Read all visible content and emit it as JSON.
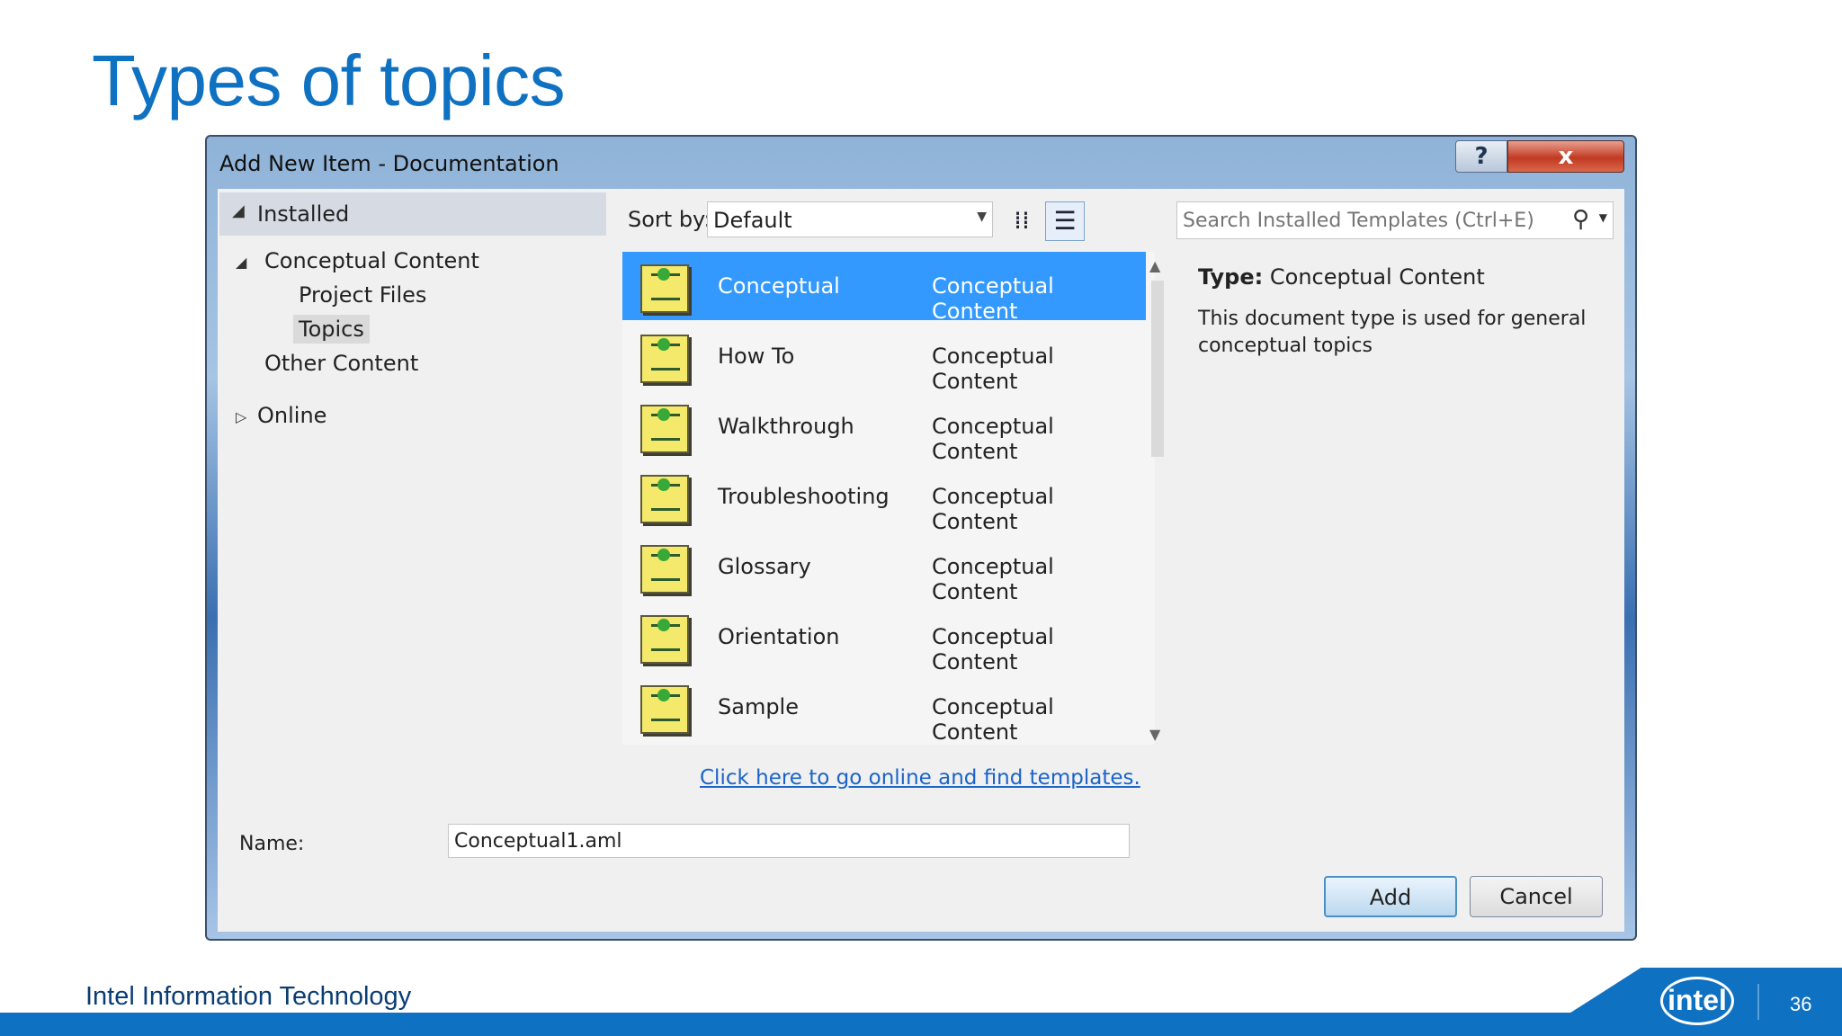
{
  "slide": {
    "title": "Types of topics",
    "footer": "Intel Information Technology",
    "page_number": "36",
    "logo_text": "intel"
  },
  "dialog": {
    "title": "Add New Item - Documentation",
    "help_label": "?",
    "close_label": "x",
    "tree": {
      "header": "Installed",
      "items": [
        {
          "label": "Conceptual Content",
          "expanded": true
        },
        {
          "label": "Project Files"
        },
        {
          "label": "Topics",
          "selected": true
        },
        {
          "label": "Other Content"
        },
        {
          "label": "Online",
          "expanded": false
        }
      ]
    },
    "sort": {
      "label": "Sort by:",
      "value": "Default"
    },
    "templates": [
      {
        "name": "Conceptual",
        "category": "Conceptual Content",
        "selected": true
      },
      {
        "name": "How To",
        "category": "Conceptual Content"
      },
      {
        "name": "Walkthrough",
        "category": "Conceptual Content"
      },
      {
        "name": "Troubleshooting",
        "category": "Conceptual Content"
      },
      {
        "name": "Glossary",
        "category": "Conceptual Content"
      },
      {
        "name": "Orientation",
        "category": "Conceptual Content"
      },
      {
        "name": "Sample",
        "category": "Conceptual Content"
      }
    ],
    "online_link": "Click here to go online and find templates.",
    "search": {
      "placeholder": "Search Installed Templates (Ctrl+E)"
    },
    "details": {
      "type_label": "Type:",
      "type_value": "Conceptual Content",
      "description": "This document type is used for general conceptual topics"
    },
    "name_field": {
      "label": "Name:",
      "value": "Conceptual1.aml"
    },
    "buttons": {
      "add": "Add",
      "cancel": "Cancel"
    }
  },
  "colors": {
    "accent": "#0f71c2",
    "selection": "#3399ff",
    "link": "#1a64c8"
  }
}
